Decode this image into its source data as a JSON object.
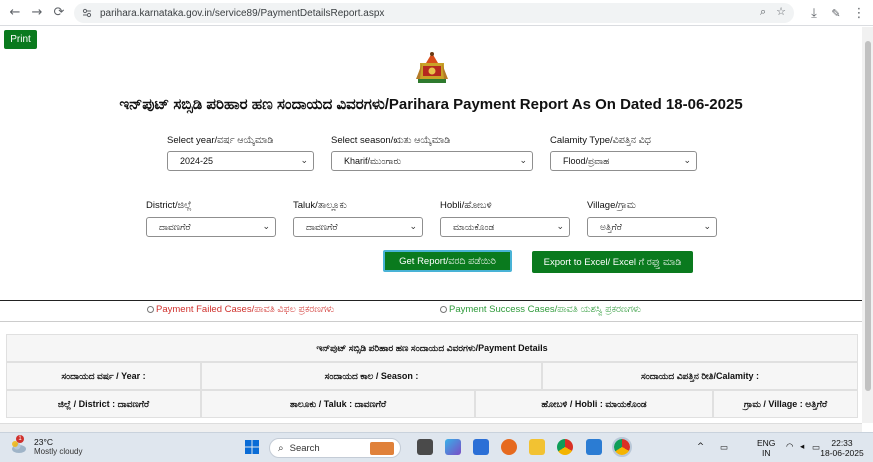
{
  "browser": {
    "back": "←",
    "forward": "→",
    "reload": "⟳",
    "url": "parihara.karnataka.gov.in/service89/PaymentDetailsReport.aspx",
    "zoom_icon": "⌕",
    "star_icon": "☆",
    "download_icon": "⤓",
    "menu_icon": "⋮"
  },
  "page": {
    "print_label": "Print",
    "title": "ಇನ್‌ಪುಟ್ ಸಬ್ಸಿಡಿ ಪರಿಹಾರ ಹಣ ಸಂದಾಯದ ವಿವರಗಳು/Parihara Payment Report As On Dated 18-06-2025",
    "filters": {
      "year": {
        "label": "Select year/ವರ್ಷ ಆಯ್ಕೆಮಾಡಿ",
        "value": "2024-25"
      },
      "season": {
        "label": "Select season/ಋತು ಆಯ್ಕೆಮಾಡಿ",
        "value": "Kharif/ಮುಂಗಾರು"
      },
      "calamity": {
        "label": "Calamity Type/ವಿಪತ್ತಿನ ವಿಧ",
        "value": "Flood/ಪ್ರವಾಹ"
      },
      "district": {
        "label": "District/ಜಿಲ್ಲೆ",
        "value": "ದಾವಣಗೆರೆ"
      },
      "taluk": {
        "label": "Taluk/ತಾಲ್ಲೂಕು",
        "value": "ದಾವಣಗೆರೆ"
      },
      "hobli": {
        "label": "Hobli/ಹೋಬಳಿ",
        "value": "ಮಾಯಕೊಂಡ"
      },
      "village": {
        "label": "Village/ಗ್ರಾಮ",
        "value": "ಅತ್ತಿಗೆರೆ"
      }
    },
    "get_report_label": "Get Report/ವರದಿ ಪಡೆಯಿರಿ",
    "export_label": "Export to Excel/ Excel ಗೆ ರಫ್ತು ಮಾಡಿ",
    "radio_failed": "Payment Failed Cases/ಪಾವತಿ ವಿಫಲ ಪ್ರಕರಣಗಳು",
    "radio_success": "Payment Success Cases/ಪಾವತಿ ಯಶಸ್ವಿ ಪ್ರಕರಣಗಳು",
    "colors": {
      "failed": "#d0312d",
      "success": "#2e9a3a",
      "green": "#0a7a1e"
    },
    "table": {
      "header": "ಇನ್‌ಪುಟ್ ಸಬ್ಸಿಡಿ ಪರಿಹಾರ ಹಣ ಸಂದಾಯದ ವಿವರಗಳು/Payment Details",
      "year": "ಸಂದಾಯದ ವರ್ಷ / Year :",
      "season": "ಸಂದಾಯದ ಕಾಲ / Season :",
      "calamity": "ಸಂದಾಯದ ವಿಪತ್ತಿನ ರೀತಿ/Calamity :",
      "district": "ಜಿಲ್ಲೆ / District : ದಾವಣಗೆರೆ",
      "taluk": "ತಾಲೂಕು / Taluk : ದಾವಣಗೆರೆ",
      "hobli": "ಹೋಬಳಿ / Hobli : ಮಾಯಕೊಂಡ",
      "village": "ಗ್ರಾಮ / Village : ಅತ್ತಿಗೆರೆ"
    }
  },
  "taskbar": {
    "weather_badge": "1",
    "temp": "23°C",
    "condition": "Mostly cloudy",
    "search_label": "Search",
    "lang_top": "ENG",
    "lang_bottom": "IN",
    "time": "22:33",
    "date": "18-06-2025"
  }
}
